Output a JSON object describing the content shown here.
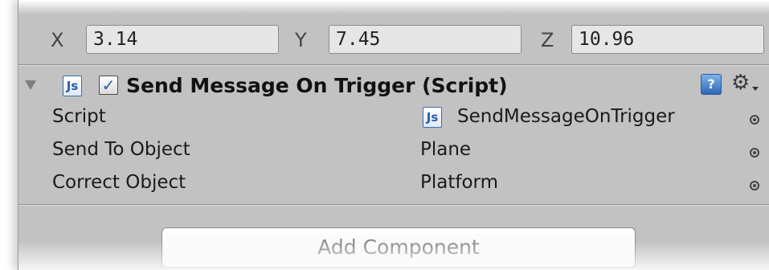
{
  "transform": {
    "x_label": "X",
    "x_value": "3.14",
    "y_label": "Y",
    "y_value": "7.45",
    "z_label": "Z",
    "z_value": "10.96"
  },
  "component": {
    "title": "Send Message On Trigger (Script)",
    "enabled_checkmark": "✓",
    "script_icon_text": "Js",
    "help_icon_text": "?",
    "settings_icon": "⚙",
    "properties": [
      {
        "label": "Script",
        "value": "SendMessageOnTrigger",
        "has_script_icon": true
      },
      {
        "label": "Send To Object",
        "value": "Plane"
      },
      {
        "label": "Correct Object",
        "value": "Platform"
      }
    ]
  },
  "add_component_label": "Add Component",
  "colors": {
    "panel_bg": "#c2c2c2",
    "field_bg": "#e6e6e6",
    "script_icon_blue": "#2a5ea8"
  }
}
